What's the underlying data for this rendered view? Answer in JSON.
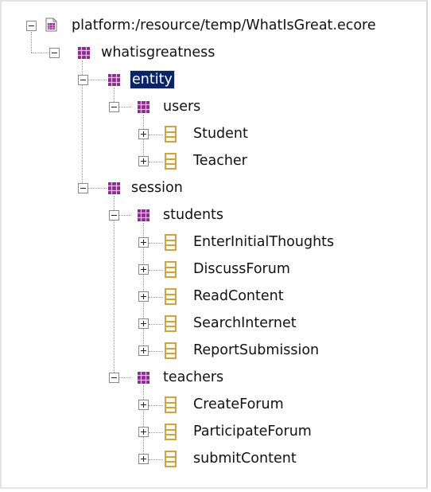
{
  "tree": {
    "root": {
      "label": "platform:/resource/temp/WhatIsGreat.ecore",
      "icon": "ecore-resource-icon",
      "expanded": true
    },
    "package_whatisgreatness": {
      "label": "whatisgreatness",
      "icon": "epackage-icon",
      "expanded": true
    },
    "package_entity": {
      "label": "entity",
      "icon": "epackage-icon",
      "expanded": true,
      "selected": true
    },
    "package_users": {
      "label": "users",
      "icon": "epackage-icon",
      "expanded": true
    },
    "class_student": {
      "label": "Student",
      "icon": "eclass-icon",
      "expanded": false
    },
    "class_teacher": {
      "label": "Teacher",
      "icon": "eclass-icon",
      "expanded": false
    },
    "package_session": {
      "label": "session",
      "icon": "epackage-icon",
      "expanded": true
    },
    "package_students": {
      "label": "students",
      "icon": "epackage-icon",
      "expanded": true
    },
    "class_enterinitialthoughts": {
      "label": "EnterInitialThoughts",
      "icon": "eclass-icon",
      "expanded": false
    },
    "class_discussforum": {
      "label": "DiscussForum",
      "icon": "eclass-icon",
      "expanded": false
    },
    "class_readcontent": {
      "label": "ReadContent",
      "icon": "eclass-icon",
      "expanded": false
    },
    "class_searchinternet": {
      "label": "SearchInternet",
      "icon": "eclass-icon",
      "expanded": false
    },
    "class_reportsubmission": {
      "label": "ReportSubmission",
      "icon": "eclass-icon",
      "expanded": false
    },
    "package_teachers": {
      "label": "teachers",
      "icon": "epackage-icon",
      "expanded": true
    },
    "class_createforum": {
      "label": "CreateForum",
      "icon": "eclass-icon",
      "expanded": false
    },
    "class_participateforum": {
      "label": "ParticipateForum",
      "icon": "eclass-icon",
      "expanded": false
    },
    "class_submitcontent": {
      "label": "submitContent",
      "icon": "eclass-icon",
      "expanded": false
    }
  },
  "colors": {
    "selection": "#0a246a",
    "package_icon": "#8b2a8f",
    "class_icon": "#caa34a"
  }
}
